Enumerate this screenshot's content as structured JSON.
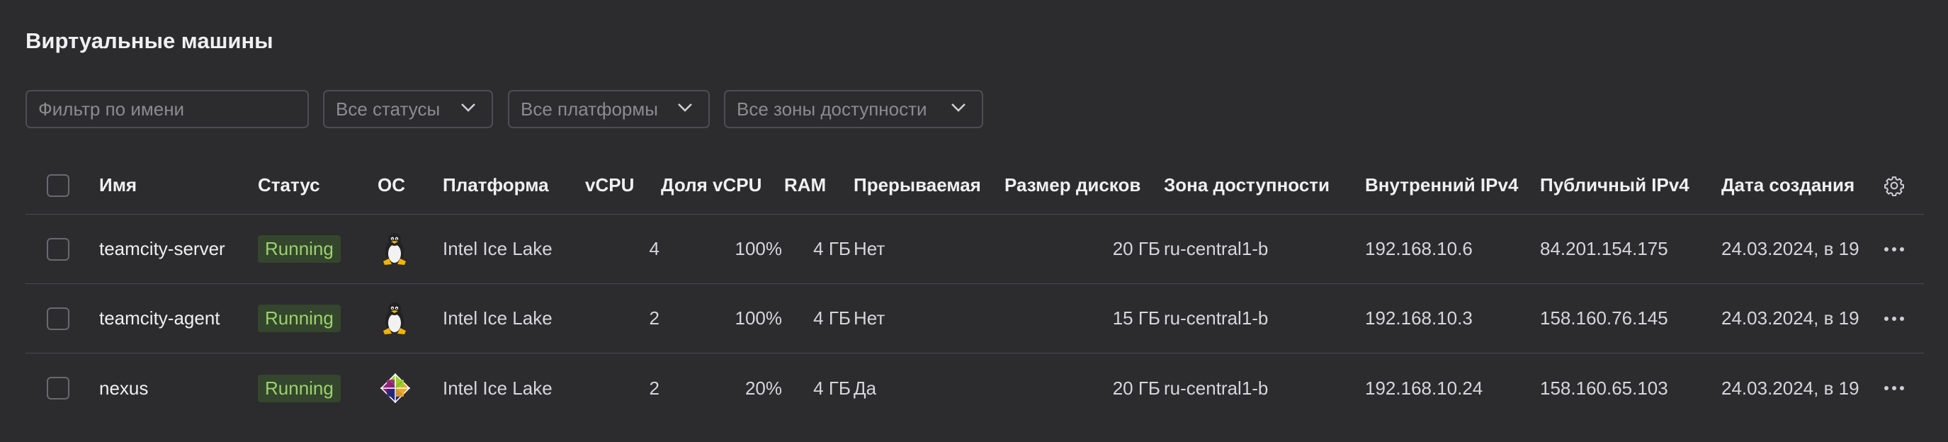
{
  "page": {
    "title": "Виртуальные машины"
  },
  "filters": {
    "name_placeholder": "Фильтр по имени",
    "status": "Все статусы",
    "platform": "Все платформы",
    "zone": "Все зоны доступности"
  },
  "table": {
    "headers": {
      "name": "Имя",
      "status": "Статус",
      "os": "ОС",
      "platform": "Платформа",
      "vcpu": "vCPU",
      "vcpu_share": "Доля vCPU",
      "ram": "RAM",
      "preemptible": "Прерываемая",
      "disk_size": "Размер дисков",
      "zone": "Зона доступности",
      "internal_ip": "Внутренний IPv4",
      "public_ip": "Публичный IPv4",
      "created": "Дата создания"
    },
    "rows": [
      {
        "name": "teamcity-server",
        "status": "Running",
        "os_icon": "linux-tux-icon",
        "platform": "Intel Ice Lake",
        "vcpu": "4",
        "vcpu_share": "100%",
        "ram": "4 ГБ",
        "preemptible": "Нет",
        "disk_size": "20 ГБ",
        "zone": "ru-central1-b",
        "internal_ip": "192.168.10.6",
        "public_ip": "84.201.154.175",
        "created": "24.03.2024, в 19"
      },
      {
        "name": "teamcity-agent",
        "status": "Running",
        "os_icon": "linux-tux-icon",
        "platform": "Intel Ice Lake",
        "vcpu": "2",
        "vcpu_share": "100%",
        "ram": "4 ГБ",
        "preemptible": "Нет",
        "disk_size": "15 ГБ",
        "zone": "ru-central1-b",
        "internal_ip": "192.168.10.3",
        "public_ip": "158.160.76.145",
        "created": "24.03.2024, в 19"
      },
      {
        "name": "nexus",
        "status": "Running",
        "os_icon": "centos-icon",
        "platform": "Intel Ice Lake",
        "vcpu": "2",
        "vcpu_share": "20%",
        "ram": "4 ГБ",
        "preemptible": "Да",
        "disk_size": "20 ГБ",
        "zone": "ru-central1-b",
        "internal_ip": "192.168.10.24",
        "public_ip": "158.160.65.103",
        "created": "24.03.2024, в 19"
      }
    ]
  },
  "colors": {
    "background": "#2c2b2e",
    "status_running_bg": "#34462d",
    "status_running_fg": "#9bd26b"
  }
}
